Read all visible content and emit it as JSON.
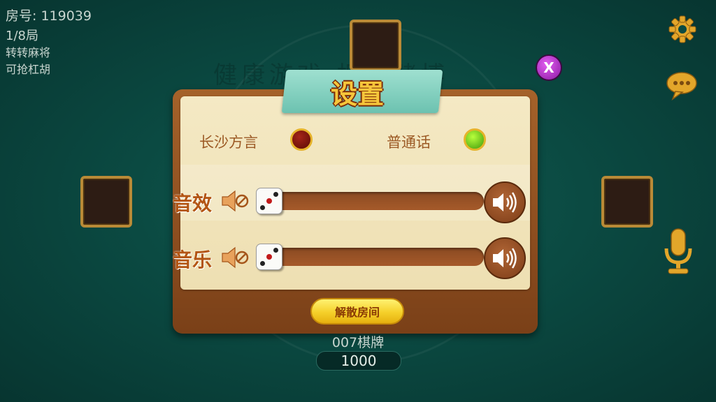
{
  "watermark": "健康游戏 拒绝赌博",
  "room": {
    "room_number": "房号: 119039",
    "round": "1/8局",
    "rules": [
      "转转麻将",
      "可抢杠胡"
    ]
  },
  "settings": {
    "title": "设置",
    "close_label": "X",
    "dialect_option": "长沙方言",
    "mandarin_option": "普通话",
    "selected_language": "普通话",
    "sound_effects_label": "音效",
    "music_label": "音乐",
    "sound_effects_level": 0,
    "music_level": 0,
    "dissolve_room_label": "解散房间"
  },
  "player": {
    "name": "007棋牌",
    "score": "1000"
  },
  "icons": [
    "gear-icon",
    "chat-icon",
    "microphone-icon",
    "mute-icon",
    "speaker-icon",
    "dice-icon"
  ],
  "colors": {
    "table": "#0b4a42",
    "panel_wood": "#8c4d1f",
    "paper": "#f4e9c4",
    "ribbon": "#7fcfbd",
    "title_gold": "#f6c63a",
    "button_yellow": "#f5d02a",
    "selected_radio": "#7fd61c",
    "unselected_radio": "#8a170f"
  }
}
